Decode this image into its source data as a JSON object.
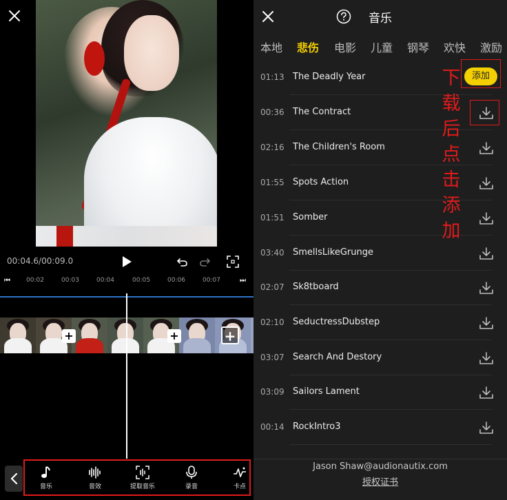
{
  "editor": {
    "timecode": "00:04.6/00:09.0",
    "ruler_labels": [
      "00:02",
      "00:03",
      "00:04",
      "00:05",
      "00:06",
      "00:07"
    ],
    "toolbar": [
      {
        "label": "音乐",
        "icon": "music-note-icon"
      },
      {
        "label": "音效",
        "icon": "sound-wave-icon"
      },
      {
        "label": "提取音乐",
        "icon": "extract-music-icon"
      },
      {
        "label": "录音",
        "icon": "microphone-icon"
      },
      {
        "label": "卡点",
        "icon": "beat-sync-icon"
      }
    ],
    "plus_symbol": "+"
  },
  "music": {
    "title": "音乐",
    "tabs": [
      "本地",
      "悲伤",
      "电影",
      "儿童",
      "钢琴",
      "欢快",
      "激励"
    ],
    "active_tab": "悲伤",
    "add_label": "添加",
    "tracks": [
      {
        "duration": "01:13",
        "name": "The Deadly Year"
      },
      {
        "duration": "00:36",
        "name": "The Contract"
      },
      {
        "duration": "02:16",
        "name": "The Children's Room"
      },
      {
        "duration": "01:55",
        "name": "Spots Action"
      },
      {
        "duration": "01:51",
        "name": "Somber"
      },
      {
        "duration": "03:40",
        "name": "SmellsLikeGrunge"
      },
      {
        "duration": "02:07",
        "name": "Sk8tboard"
      },
      {
        "duration": "02:10",
        "name": "SeductressDubstep"
      },
      {
        "duration": "03:07",
        "name": "Search And Destory"
      },
      {
        "duration": "03:09",
        "name": "Sailors Lament"
      },
      {
        "duration": "00:14",
        "name": "RockIntro3"
      }
    ],
    "credit": "Jason Shaw@audionautix.com",
    "license_link": "授权证书"
  },
  "annotation": {
    "chars": [
      "下",
      "载",
      "后",
      "点",
      "击",
      "添",
      "加"
    ],
    "color": "#e01b1b"
  },
  "colors": {
    "accent": "#f5d000",
    "annotation_red": "#e01b1b",
    "timeline_blue": "#2c74c9"
  }
}
